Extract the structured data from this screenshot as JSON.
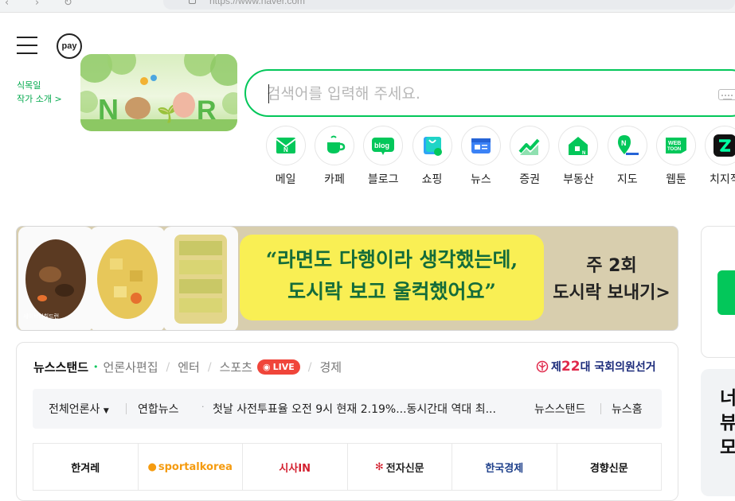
{
  "browser": {
    "url": "https://www.naver.com"
  },
  "header": {
    "pay_label": "pay"
  },
  "doodle": {
    "caption_line1": "식목일",
    "caption_line2": "작가 소개 >",
    "logo_text": "NAVER"
  },
  "search": {
    "placeholder": "검색어를 입력해 주세요."
  },
  "services": [
    {
      "label": "메일",
      "icon": "mail-icon"
    },
    {
      "label": "카페",
      "icon": "cafe-cup-icon"
    },
    {
      "label": "블로그",
      "icon": "blog-icon"
    },
    {
      "label": "쇼핑",
      "icon": "shopping-bag-icon"
    },
    {
      "label": "뉴스",
      "icon": "news-icon"
    },
    {
      "label": "증권",
      "icon": "stock-chart-icon"
    },
    {
      "label": "부동산",
      "icon": "house-icon"
    },
    {
      "label": "지도",
      "icon": "map-pin-icon"
    },
    {
      "label": "웹툰",
      "icon": "webtoon-icon"
    },
    {
      "label": "치지직",
      "icon": "chzzk-icon"
    }
  ],
  "ad": {
    "quote_line1": "“라면도 다행이라 생각했는데,",
    "quote_line2": "도시락 보고 울컥했어요”",
    "cta_line1": "주 2회",
    "cta_line2": "도시락 보내기>",
    "brand": "세이브더칠드런"
  },
  "newsstand": {
    "tabs": [
      "뉴스스탠드",
      "언론사편집",
      "엔터",
      "스포츠",
      "경제"
    ],
    "live_badge": "LIVE",
    "election_prefix": "제",
    "election_number": "22",
    "election_suffix": "대 국회의원선거",
    "ticker": {
      "all_press": "전체언론사",
      "press": "연합뉴스",
      "headline": "첫날 사전투표율 오전 9시 현재 2.19%...동시간대 역대 최...",
      "link_newsstand": "뉴스스탠드",
      "link_home": "뉴스홈"
    },
    "logos": [
      "한겨레",
      "sportalkorea",
      "시사IN",
      "전자신문",
      "한국경제",
      "경향신문"
    ]
  },
  "colors": {
    "brand_green": "#03c75a",
    "live_red": "#f0453a",
    "ad_yellow": "#f9ef54"
  },
  "side": {
    "text": "너뷰모"
  }
}
